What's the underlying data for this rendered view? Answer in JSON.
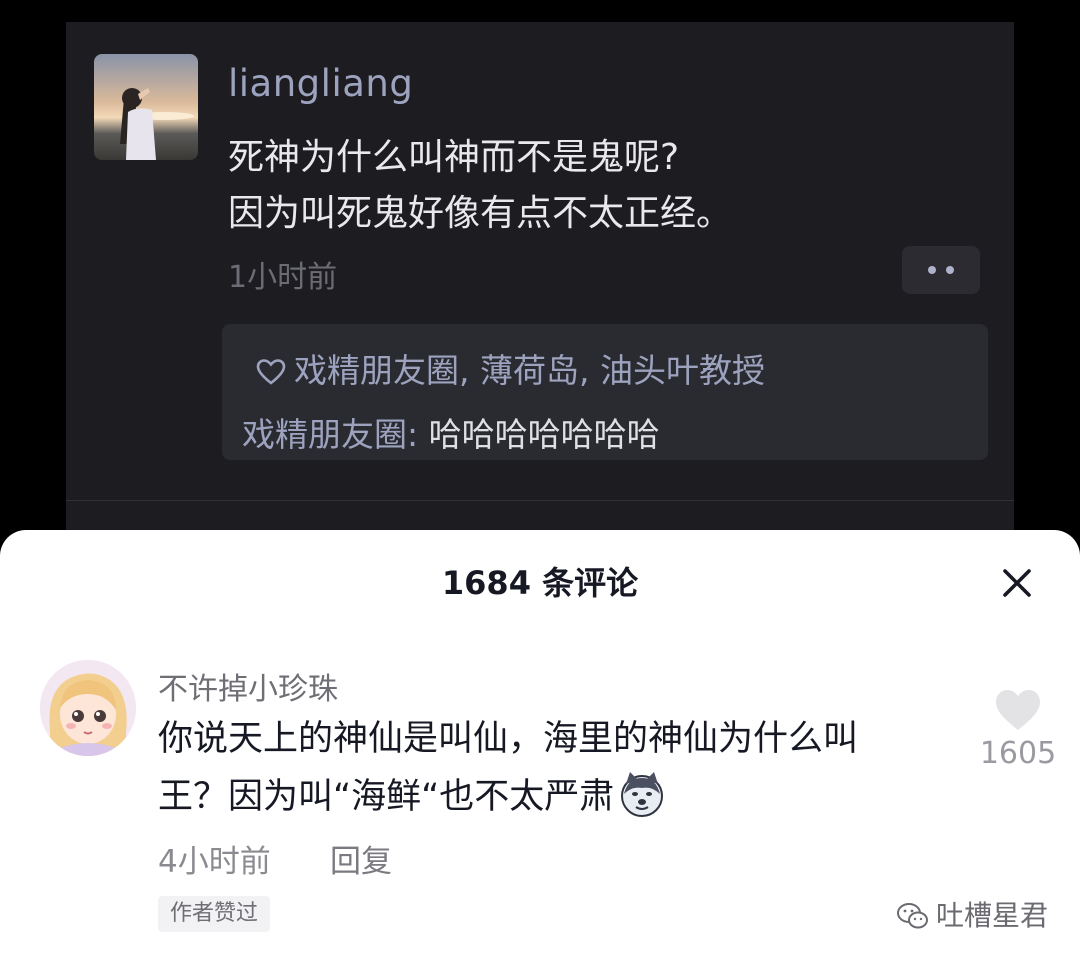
{
  "post": {
    "username": "liangliang",
    "text_lines": [
      "死神为什么叫神而不是鬼呢?",
      "因为叫死鬼好像有点不太正经。"
    ],
    "time": "1小时前",
    "likes": "戏精朋友圈, 薄荷岛, 油头叶教授",
    "reply": {
      "user": "戏精朋友圈",
      "separator": ": ",
      "text": "哈哈哈哈哈哈哈"
    }
  },
  "comments_sheet": {
    "title": "1684 条评论",
    "comment": {
      "username": "不许掉小珍珠",
      "text_lines": [
        "你说天上的神仙是叫仙，海里的神仙为什么叫",
        "王？因为叫“海鲜“也不太严肃"
      ],
      "emoji": "doge-emoji",
      "time": "4小时前",
      "reply_label": "回复",
      "badge": "作者赞过",
      "like_count": "1605"
    }
  },
  "watermark": {
    "label": "吐槽星君",
    "icon": "wechat-icon"
  },
  "colors": {
    "dark_bg": "#1d1d21",
    "username_blue": "#9da3bf",
    "sheet_bg": "#ffffff"
  }
}
